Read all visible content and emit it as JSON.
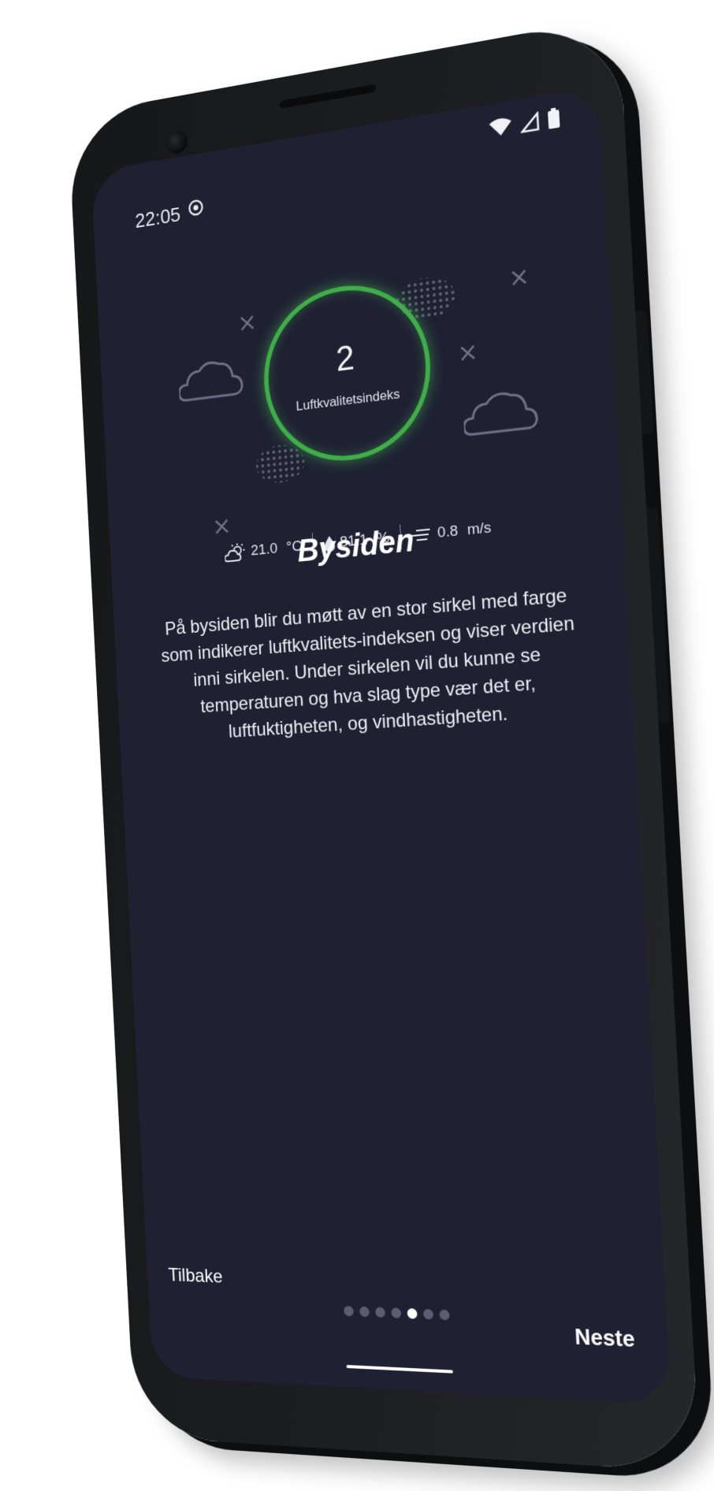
{
  "status_bar": {
    "time": "22:05",
    "app_icon": "app-notification-icon",
    "icons": [
      "wifi-icon",
      "signal-icon",
      "battery-icon"
    ]
  },
  "aqi": {
    "value": "2",
    "label": "Luftkvalitetsindeks",
    "ring_color": "#3fae49"
  },
  "weather": {
    "temperature": "21.0",
    "temperature_unit": "°C",
    "temperature_icon": "partly-cloudy-icon",
    "humidity": "81.1",
    "humidity_unit": "%",
    "humidity_icon": "water-drop-icon",
    "wind": "0.8",
    "wind_unit": "m/s",
    "wind_icon": "wind-icon"
  },
  "onboarding": {
    "title": "Bysiden",
    "description": "På bysiden blir du møtt av en stor sirkel med farge som indikerer luftkvalitets-indeksen og viser verdien inni sirkelen. Under sirkelen vil du kunne se temperaturen og hva slag type vær det er, luftfuktigheten, og vindhastigheten.",
    "page_count": 7,
    "active_page": 5
  },
  "navigation": {
    "back_label": "Tilbake",
    "next_label": "Neste"
  },
  "colors": {
    "screen_background": "#1f2133",
    "accent_green": "#3fae49",
    "text": "#ffffff"
  }
}
